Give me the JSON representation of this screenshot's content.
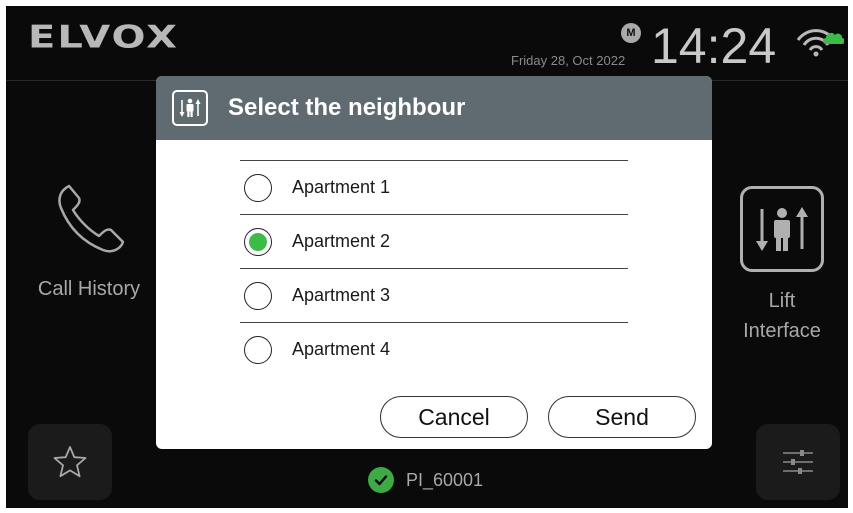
{
  "header": {
    "logo_text": "ELVOX",
    "date": "Friday 28, Oct 2022",
    "badge": "M",
    "time": "14:24",
    "wifi_icon": "wifi-cloud-icon"
  },
  "tiles": {
    "call_history": {
      "label": "Call History",
      "icon": "phone-icon"
    },
    "lift": {
      "label_line1": "Lift",
      "label_line2": "Interface",
      "icon": "lift-icon"
    }
  },
  "bottom": {
    "favorites_icon": "star-icon",
    "settings_icon": "sliders-icon",
    "status_text": "PI_60001"
  },
  "dialog": {
    "title": "Select the neighbour",
    "options": [
      {
        "label": "Apartment 1",
        "selected": false
      },
      {
        "label": "Apartment 2",
        "selected": true
      },
      {
        "label": "Apartment 3",
        "selected": false
      },
      {
        "label": "Apartment 4",
        "selected": false
      }
    ],
    "cancel_label": "Cancel",
    "send_label": "Send"
  },
  "colors": {
    "accent_green": "#3dbb48",
    "dialog_header": "#5f6b71",
    "screen_bg": "#0a0a0a"
  }
}
